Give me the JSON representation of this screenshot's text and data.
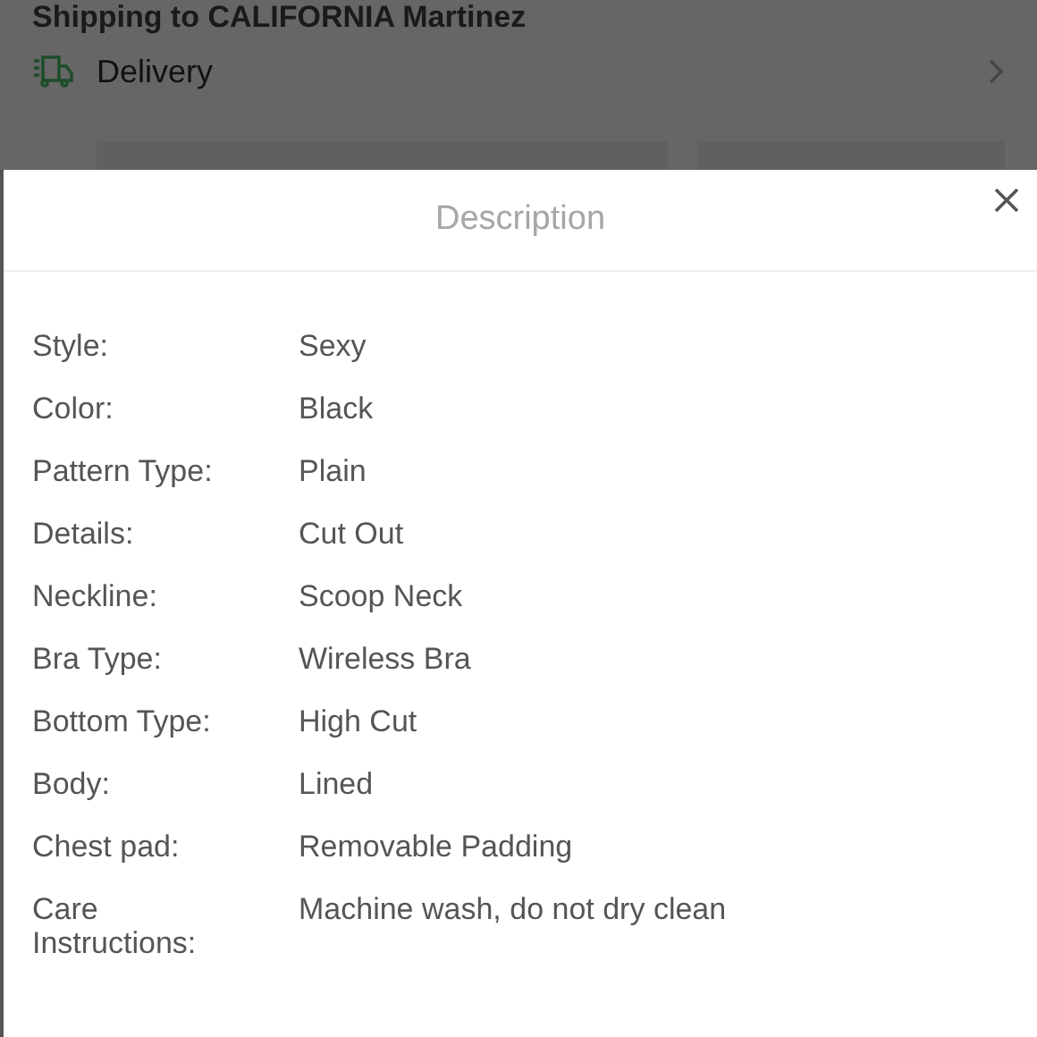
{
  "background": {
    "shipping_heading": "Shipping to CALIFORNIA Martinez",
    "delivery": {
      "label": "Delivery"
    }
  },
  "modal": {
    "title": "Description",
    "rows": [
      {
        "label": "Style:",
        "value": "Sexy"
      },
      {
        "label": "Color:",
        "value": "Black"
      },
      {
        "label": "Pattern Type:",
        "value": "Plain"
      },
      {
        "label": "Details:",
        "value": "Cut Out"
      },
      {
        "label": "Neckline:",
        "value": "Scoop Neck"
      },
      {
        "label": "Bra Type:",
        "value": "Wireless Bra"
      },
      {
        "label": "Bottom Type:",
        "value": "High Cut"
      },
      {
        "label": "Body:",
        "value": "Lined"
      },
      {
        "label": "Chest pad:",
        "value": "Removable Padding"
      },
      {
        "label": "Care Instructions:",
        "value": "Machine wash, do not dry clean"
      }
    ]
  }
}
